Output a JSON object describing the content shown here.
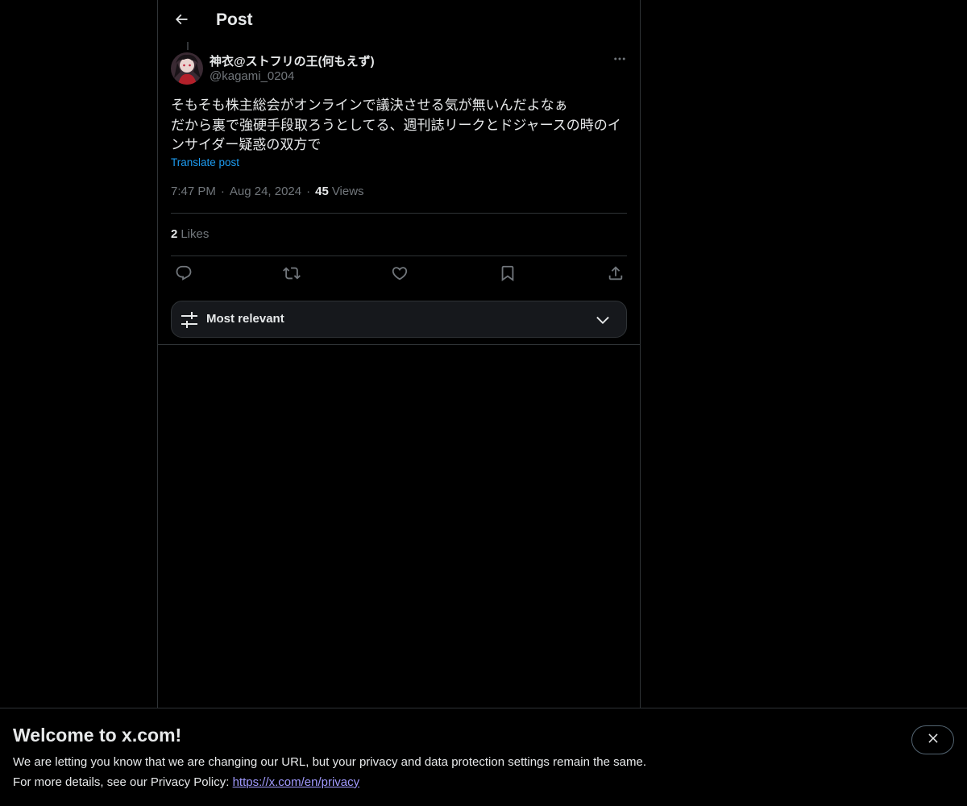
{
  "header": {
    "title": "Post"
  },
  "post": {
    "author": {
      "display_name": "神衣@ストフリの王(何もえず)",
      "handle": "@kagami_0204"
    },
    "text_lines": [
      "そもそも株主総会がオンラインで議決させる気が無いんだよなぁ",
      "だから裏で強硬手段取ろうとしてる、週刊誌リークとドジャースの時のイ",
      "ンサイダー疑惑の双方で"
    ],
    "translate_label": "Translate post",
    "time": "7:47 PM",
    "date": "Aug 24, 2024",
    "views_count": "45",
    "views_label": "Views",
    "likes_count": "2",
    "likes_label": "Likes",
    "separator": "·"
  },
  "replies_sort": {
    "label": "Most relevant"
  },
  "banner": {
    "title": "Welcome to x.com!",
    "line1": "We are letting you know that we are changing our URL, but your privacy and data protection settings remain the same.",
    "line2_prefix": "For more details, see our Privacy Policy: ",
    "link_text": "https://x.com/en/privacy"
  },
  "icons": {
    "back": "arrow-left-icon",
    "more": "more-horizontal-icon",
    "reply": "reply-icon",
    "repost": "repost-icon",
    "like": "heart-icon",
    "bookmark": "bookmark-icon",
    "share": "share-icon",
    "sort": "sliders-icon",
    "chevron": "chevron-down-icon",
    "close": "close-icon"
  },
  "colors": {
    "background": "#000000",
    "text": "#e7e9ea",
    "muted": "#71767b",
    "accent": "#1d9bf0",
    "border": "#2f3336",
    "link": "#a19aff"
  }
}
